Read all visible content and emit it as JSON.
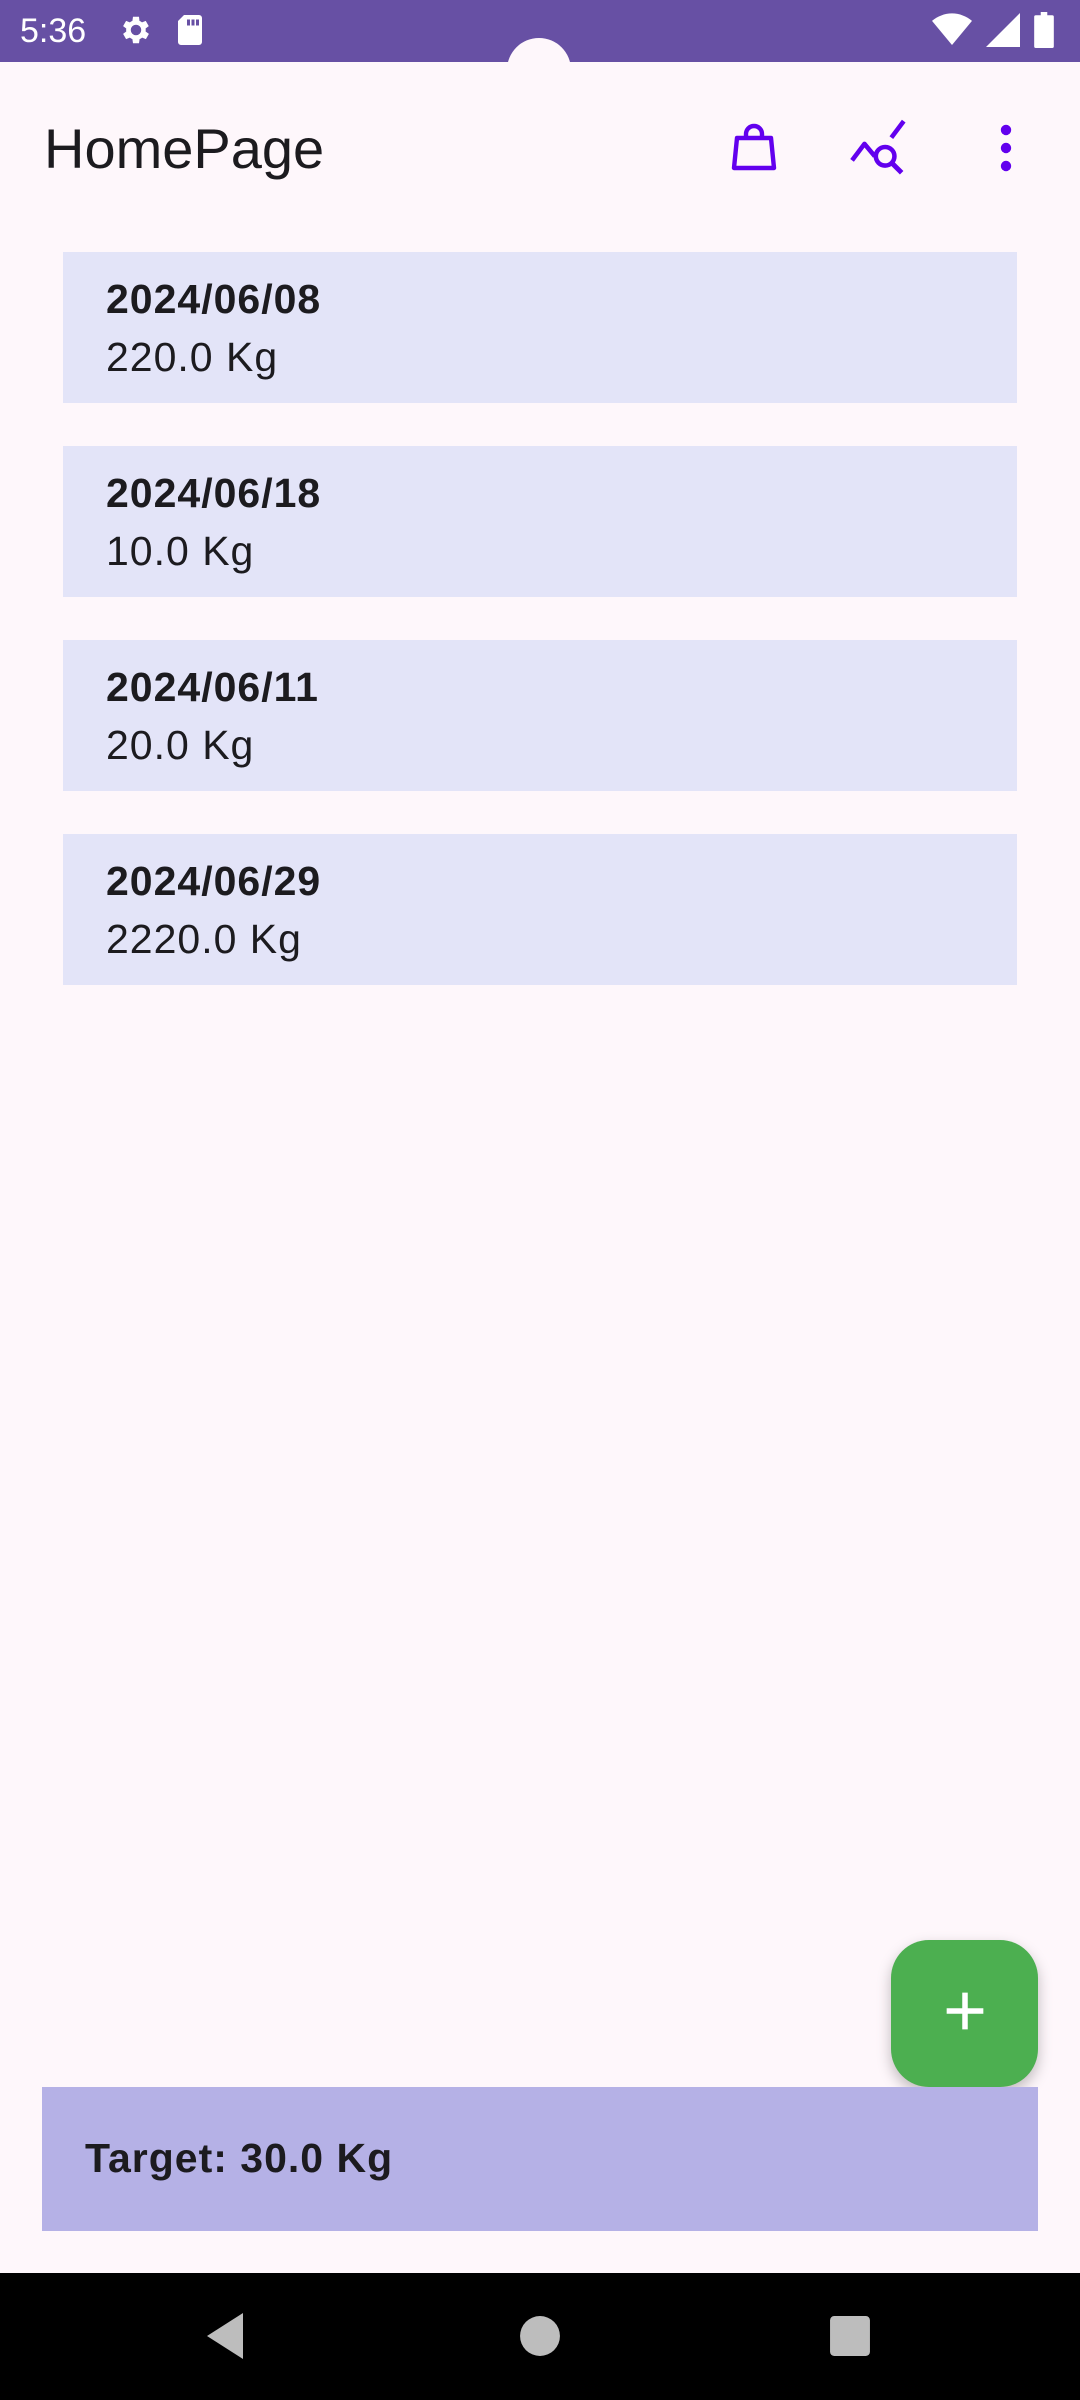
{
  "status_bar": {
    "time": "5:36",
    "left_icons": [
      "gear-icon",
      "sd-card-icon"
    ],
    "right_icons": [
      "wifi-icon",
      "signal-icon",
      "battery-icon"
    ],
    "color": "#6750a4"
  },
  "app_bar": {
    "title": "HomePage",
    "actions": [
      "shopping-bag-icon",
      "chart-search-icon",
      "more-vert-icon"
    ],
    "accent_color": "#6200ee"
  },
  "records": [
    {
      "date": "2024/06/08",
      "weight": "220.0 Kg"
    },
    {
      "date": "2024/06/18",
      "weight": "10.0 Kg"
    },
    {
      "date": "2024/06/11",
      "weight": "20.0 Kg"
    },
    {
      "date": "2024/06/29",
      "weight": "2220.0 Kg"
    }
  ],
  "fab": {
    "icon": "plus-icon",
    "color": "#4caf50"
  },
  "target": {
    "label": "Target: 30.0 Kg",
    "color": "#b5b1e6"
  },
  "nav_bar": {
    "buttons": [
      "back-icon",
      "home-icon",
      "recents-icon"
    ]
  }
}
